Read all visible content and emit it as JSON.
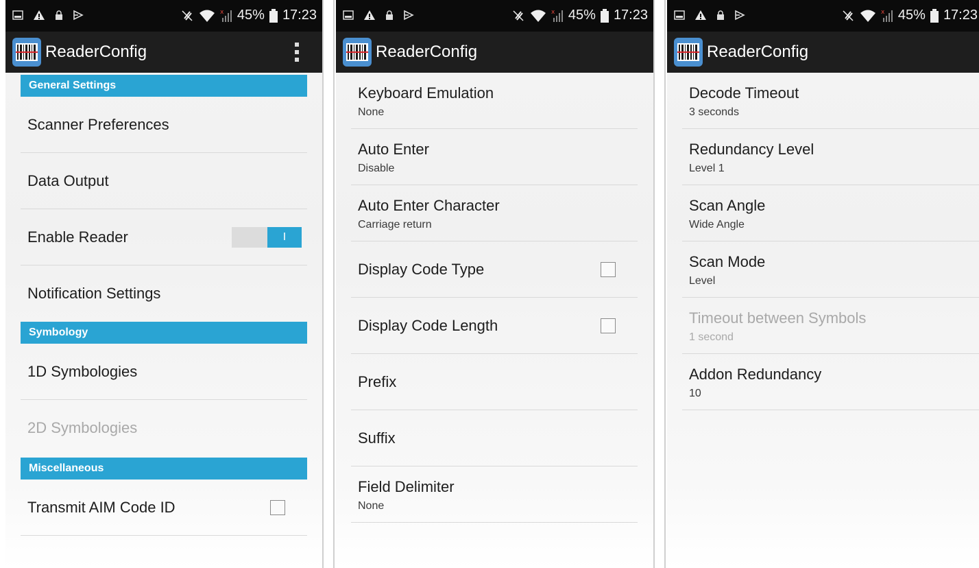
{
  "status_bar": {
    "battery": "45%",
    "time": "17:23"
  },
  "app": {
    "title": "ReaderConfig"
  },
  "screen1": {
    "sections": {
      "general": "General Settings",
      "symbology": "Symbology",
      "misc": "Miscellaneous"
    },
    "items": {
      "scanner_preferences": "Scanner Preferences",
      "data_output": "Data Output",
      "enable_reader": "Enable Reader",
      "enable_reader_toggle": "I",
      "notification_settings": "Notification Settings",
      "symbologies_1d": "1D Symbologies",
      "symbologies_2d": "2D Symbologies",
      "transmit_aim": "Transmit AIM Code ID"
    },
    "enable_reader_on": true,
    "transmit_aim_checked": false
  },
  "screen2": {
    "items": [
      {
        "title": "Keyboard Emulation",
        "summary": "None"
      },
      {
        "title": "Auto Enter",
        "summary": "Disable"
      },
      {
        "title": "Auto Enter Character",
        "summary": "Carriage return"
      },
      {
        "title": "Display Code Type",
        "checked": false
      },
      {
        "title": "Display Code Length",
        "checked": false
      },
      {
        "title": "Prefix"
      },
      {
        "title": "Suffix"
      },
      {
        "title": "Field Delimiter",
        "summary": "None"
      }
    ]
  },
  "screen3": {
    "items": [
      {
        "title": "Decode Timeout",
        "summary": "3 seconds"
      },
      {
        "title": "Redundancy Level",
        "summary": "Level 1"
      },
      {
        "title": "Scan Angle",
        "summary": "Wide Angle"
      },
      {
        "title": "Scan Mode",
        "summary": "Level"
      },
      {
        "title": "Timeout between Symbols",
        "summary": "1 second",
        "enabled": false
      },
      {
        "title": "Addon Redundancy",
        "summary": "10"
      }
    ]
  },
  "colors": {
    "accent": "#2aa4d3",
    "action_bar": "#1e1e1e",
    "status_bar": "#0b0b0b"
  },
  "icons": [
    "notification-icon",
    "warning-icon",
    "lock-icon",
    "cast-icon",
    "mute-icon",
    "wifi-icon",
    "signal-icon",
    "battery-icon",
    "barcode-app-icon",
    "overflow-menu-icon"
  ]
}
